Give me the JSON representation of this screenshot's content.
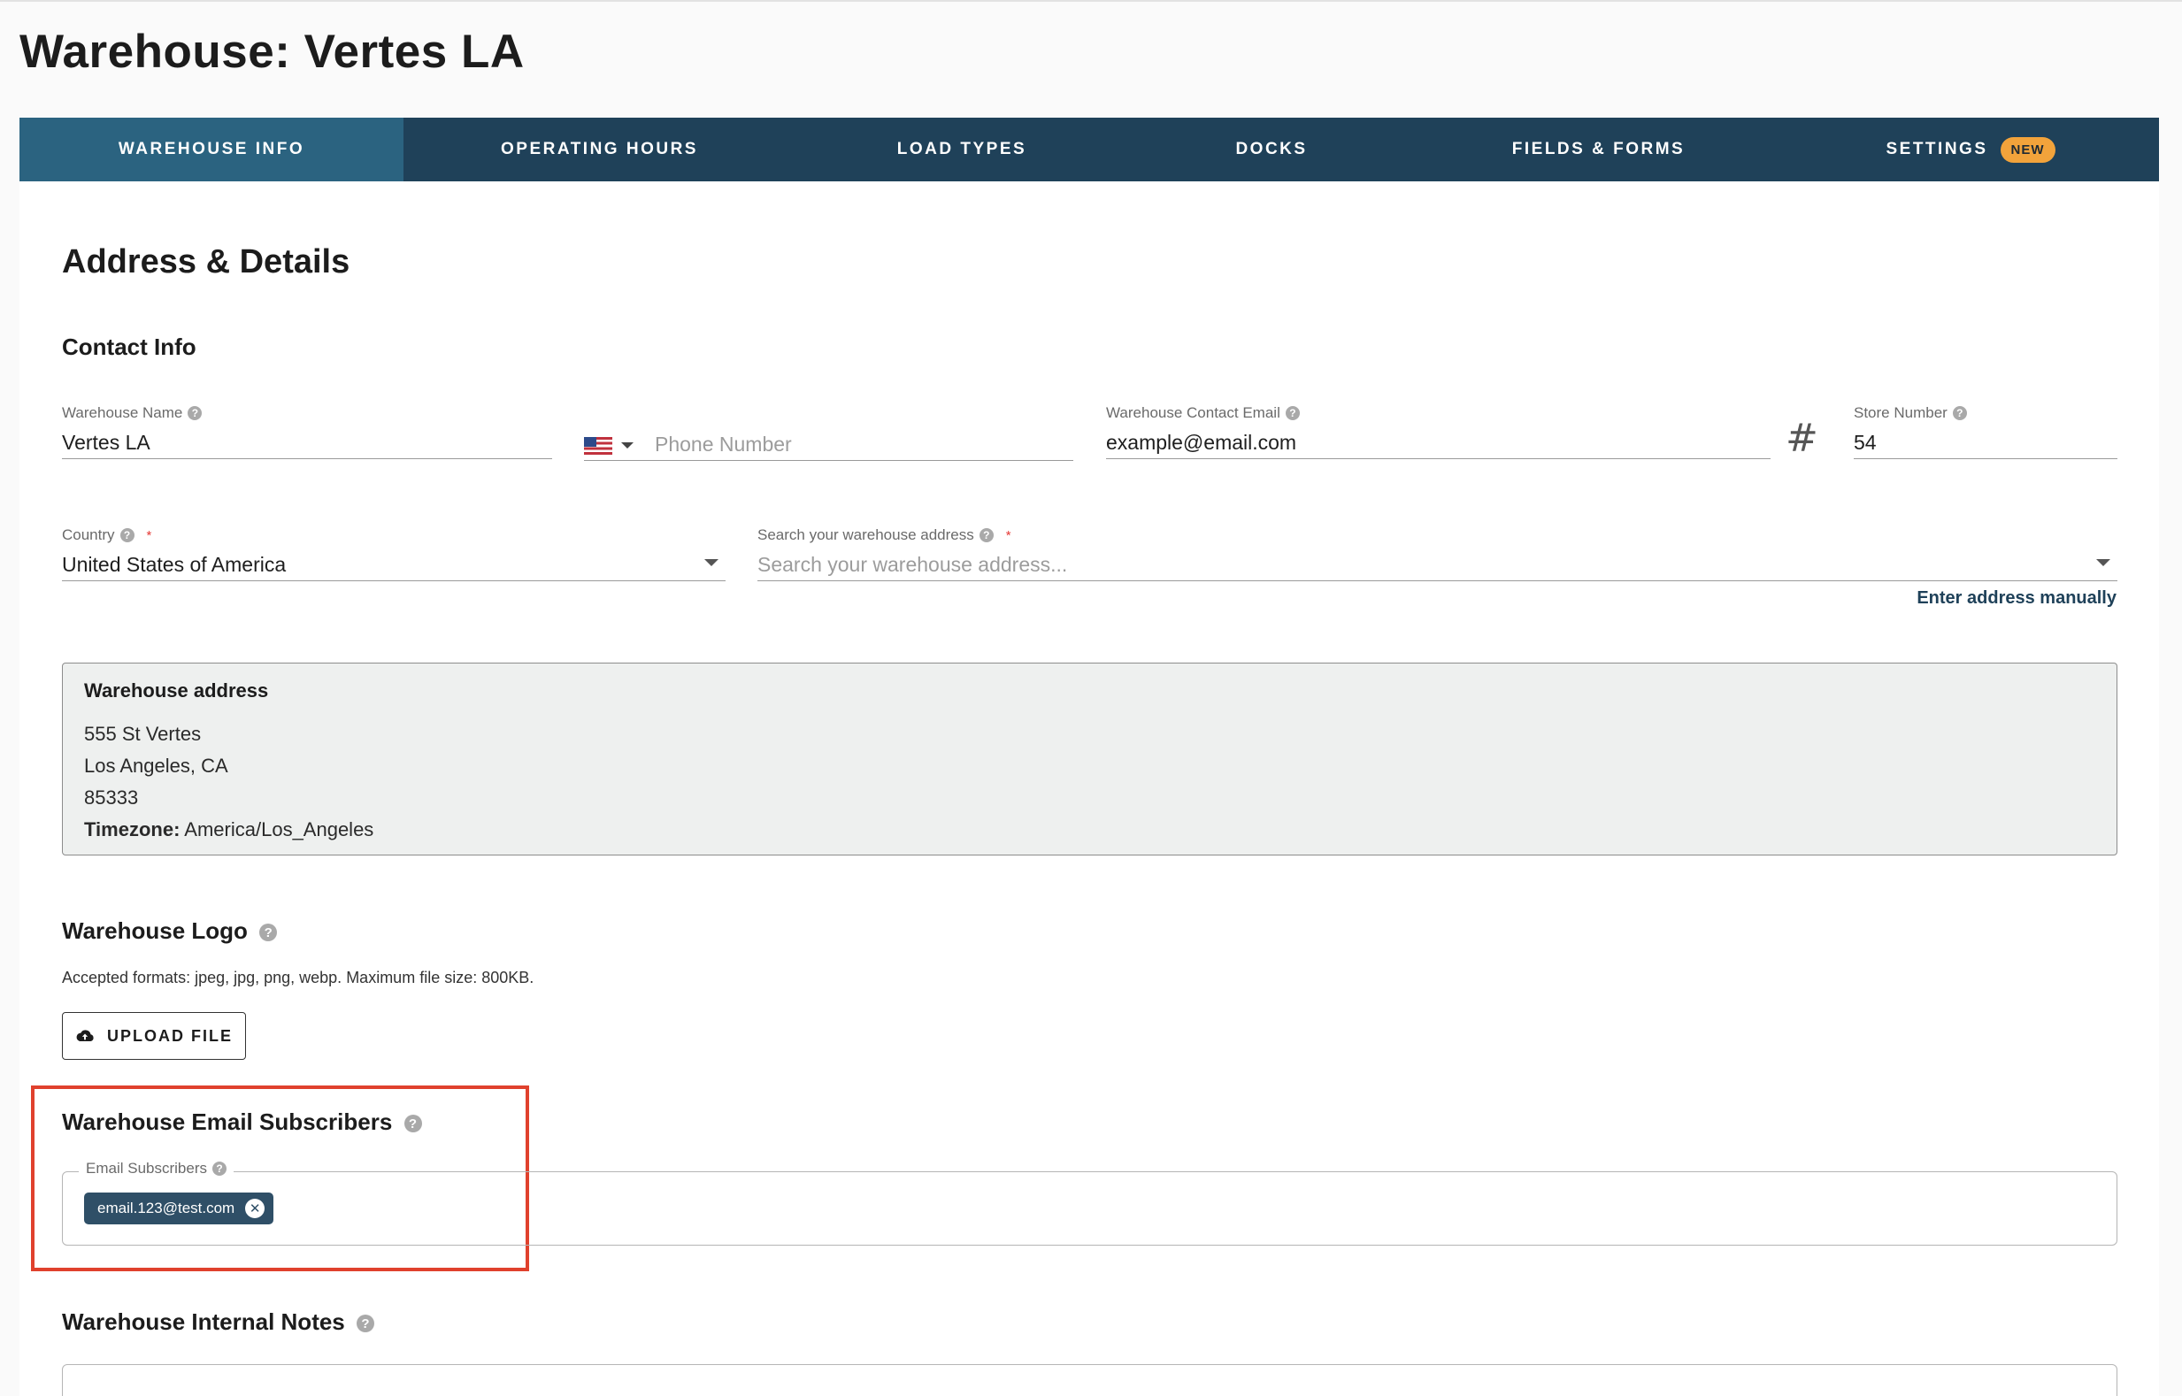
{
  "page": {
    "title": "Warehouse: Vertes LA"
  },
  "tabs": [
    {
      "label": "WAREHOUSE INFO"
    },
    {
      "label": "OPERATING HOURS"
    },
    {
      "label": "LOAD TYPES"
    },
    {
      "label": "DOCKS"
    },
    {
      "label": "FIELDS & FORMS"
    },
    {
      "label": "SETTINGS",
      "badge": "NEW"
    }
  ],
  "section": {
    "title": "Address & Details",
    "contact_title": "Contact Info"
  },
  "fields": {
    "warehouse_name": {
      "label": "Warehouse Name",
      "value": "Vertes LA"
    },
    "phone": {
      "placeholder": "Phone Number"
    },
    "contact_email": {
      "label": "Warehouse Contact Email",
      "value": "example@email.com"
    },
    "store_number": {
      "label": "Store Number",
      "value": "54"
    },
    "country": {
      "label": "Country",
      "value": "United States of America"
    },
    "address_search": {
      "label": "Search your warehouse address",
      "placeholder": "Search your warehouse address..."
    }
  },
  "links": {
    "enter_manually": "Enter address manually"
  },
  "address": {
    "title": "Warehouse address",
    "line1": "555 St Vertes",
    "line2": "Los Angeles, CA",
    "line3": "85333",
    "timezone_label": "Timezone:",
    "timezone_value": "America/Los_Angeles"
  },
  "logo": {
    "title": "Warehouse Logo",
    "note": "Accepted formats: jpeg, jpg, png, webp. Maximum file size: 800KB.",
    "upload_label": "UPLOAD FILE"
  },
  "subscribers": {
    "title": "Warehouse Email Subscribers",
    "label": "Email Subscribers",
    "chips": [
      "email.123@test.com"
    ]
  },
  "notes": {
    "title": "Warehouse Internal Notes"
  },
  "colors": {
    "nav": "#1f4159",
    "nav_active": "#2b6380",
    "badge": "#f2a33b",
    "highlight": "#e0412d"
  }
}
